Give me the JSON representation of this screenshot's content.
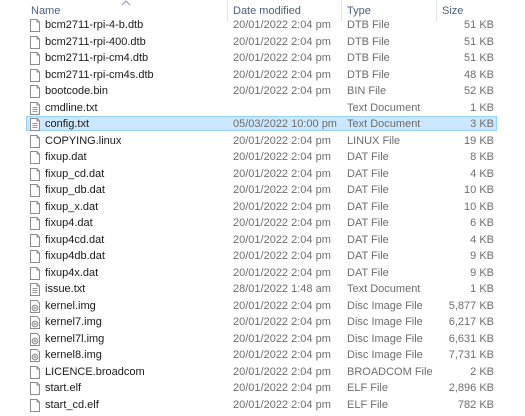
{
  "columns": {
    "name": "Name",
    "date": "Date modified",
    "type": "Type",
    "size": "Size"
  },
  "files": [
    {
      "name": "bcm2711-rpi-4-b.dtb",
      "date": "20/01/2022 2:04 pm",
      "type": "DTB File",
      "size": "51 KB",
      "icon": "blank-file-icon"
    },
    {
      "name": "bcm2711-rpi-400.dtb",
      "date": "20/01/2022 2:04 pm",
      "type": "DTB File",
      "size": "51 KB",
      "icon": "blank-file-icon"
    },
    {
      "name": "bcm2711-rpi-cm4.dtb",
      "date": "20/01/2022 2:04 pm",
      "type": "DTB File",
      "size": "51 KB",
      "icon": "blank-file-icon"
    },
    {
      "name": "bcm2711-rpi-cm4s.dtb",
      "date": "20/01/2022 2:04 pm",
      "type": "DTB File",
      "size": "48 KB",
      "icon": "blank-file-icon"
    },
    {
      "name": "bootcode.bin",
      "date": "20/01/2022 2:04 pm",
      "type": "BIN File",
      "size": "52 KB",
      "icon": "blank-file-icon"
    },
    {
      "name": "cmdline.txt",
      "date": "",
      "type": "Text Document",
      "size": "1 KB",
      "icon": "text-file-icon"
    },
    {
      "name": "config.txt",
      "date": "05/03/2022 10:00 pm",
      "type": "Text Document",
      "size": "3 KB",
      "icon": "text-file-icon",
      "selected": true
    },
    {
      "name": "COPYING.linux",
      "date": "20/01/2022 2:04 pm",
      "type": "LINUX File",
      "size": "19 KB",
      "icon": "blank-file-icon"
    },
    {
      "name": "fixup.dat",
      "date": "20/01/2022 2:04 pm",
      "type": "DAT File",
      "size": "8 KB",
      "icon": "blank-file-icon"
    },
    {
      "name": "fixup_cd.dat",
      "date": "20/01/2022 2:04 pm",
      "type": "DAT File",
      "size": "4 KB",
      "icon": "blank-file-icon"
    },
    {
      "name": "fixup_db.dat",
      "date": "20/01/2022 2:04 pm",
      "type": "DAT File",
      "size": "10 KB",
      "icon": "blank-file-icon"
    },
    {
      "name": "fixup_x.dat",
      "date": "20/01/2022 2:04 pm",
      "type": "DAT File",
      "size": "10 KB",
      "icon": "blank-file-icon"
    },
    {
      "name": "fixup4.dat",
      "date": "20/01/2022 2:04 pm",
      "type": "DAT File",
      "size": "6 KB",
      "icon": "blank-file-icon"
    },
    {
      "name": "fixup4cd.dat",
      "date": "20/01/2022 2:04 pm",
      "type": "DAT File",
      "size": "4 KB",
      "icon": "blank-file-icon"
    },
    {
      "name": "fixup4db.dat",
      "date": "20/01/2022 2:04 pm",
      "type": "DAT File",
      "size": "9 KB",
      "icon": "blank-file-icon"
    },
    {
      "name": "fixup4x.dat",
      "date": "20/01/2022 2:04 pm",
      "type": "DAT File",
      "size": "9 KB",
      "icon": "blank-file-icon"
    },
    {
      "name": "issue.txt",
      "date": "28/01/2022 1:48 am",
      "type": "Text Document",
      "size": "1 KB",
      "icon": "text-file-icon"
    },
    {
      "name": "kernel.img",
      "date": "20/01/2022 2:04 pm",
      "type": "Disc Image File",
      "size": "5,877 KB",
      "icon": "disc-image-icon"
    },
    {
      "name": "kernel7.img",
      "date": "20/01/2022 2:04 pm",
      "type": "Disc Image File",
      "size": "6,217 KB",
      "icon": "disc-image-icon"
    },
    {
      "name": "kernel7l.img",
      "date": "20/01/2022 2:04 pm",
      "type": "Disc Image File",
      "size": "6,631 KB",
      "icon": "disc-image-icon"
    },
    {
      "name": "kernel8.img",
      "date": "20/01/2022 2:04 pm",
      "type": "Disc Image File",
      "size": "7,731 KB",
      "icon": "disc-image-icon"
    },
    {
      "name": "LICENCE.broadcom",
      "date": "20/01/2022 2:04 pm",
      "type": "BROADCOM File",
      "size": "2 KB",
      "icon": "blank-file-icon"
    },
    {
      "name": "start.elf",
      "date": "20/01/2022 2:04 pm",
      "type": "ELF File",
      "size": "2,896 KB",
      "icon": "blank-file-icon"
    },
    {
      "name": "start_cd.elf",
      "date": "20/01/2022 2:04 pm",
      "type": "ELF File",
      "size": "782 KB",
      "icon": "blank-file-icon"
    }
  ],
  "colors": {
    "selection_bg": "#cce8ff",
    "selection_border": "#99d1ff",
    "header_text": "#4c607a",
    "secondary_text": "#6d6d6d"
  }
}
